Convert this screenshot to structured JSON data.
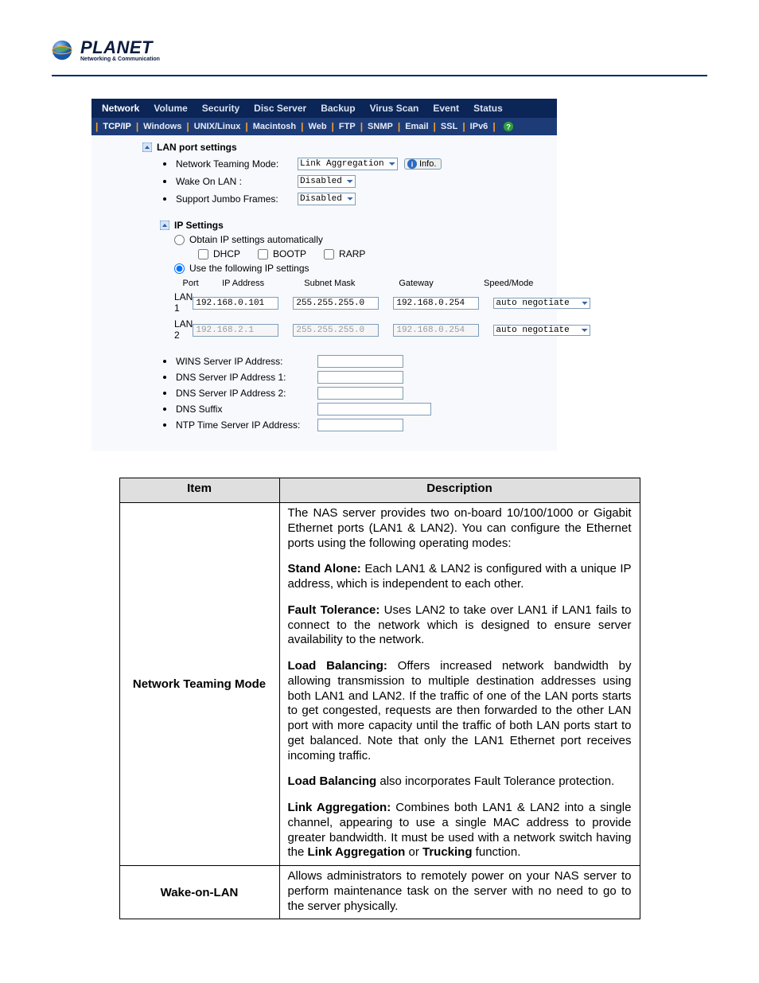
{
  "logo": {
    "brand": "PLANET",
    "tagline": "Networking & Communication"
  },
  "nav": {
    "tabs": [
      "Network",
      "Volume",
      "Security",
      "Disc Server",
      "Backup",
      "Virus Scan",
      "Event",
      "Status"
    ],
    "active": 0
  },
  "subnav": {
    "tabs": [
      "TCP/IP",
      "Windows",
      "UNIX/Linux",
      "Macintosh",
      "Web",
      "FTP",
      "SNMP",
      "Email",
      "SSL",
      "IPv6"
    ],
    "active": 0
  },
  "lan_port": {
    "heading": "LAN port settings",
    "teaming_label": "Network Teaming Mode:",
    "teaming_value": "Link Aggregation",
    "info_label": "Info.",
    "wol_label": "Wake On LAN :",
    "wol_value": "Disabled",
    "jumbo_label": "Support Jumbo Frames:",
    "jumbo_value": "Disabled"
  },
  "ip_settings": {
    "heading": "IP Settings",
    "auto_label": "Obtain IP settings automatically",
    "dhcp": "DHCP",
    "bootp": "BOOTP",
    "rarp": "RARP",
    "manual_label": "Use the following IP settings",
    "columns": {
      "port": "Port",
      "ip": "IP Address",
      "mask": "Subnet Mask",
      "gw": "Gateway",
      "speed": "Speed/Mode"
    },
    "rows": [
      {
        "port": "LAN 1",
        "ip": "192.168.0.101",
        "mask": "255.255.255.0",
        "gw": "192.168.0.254",
        "speed": "auto negotiate",
        "enabled": true
      },
      {
        "port": "LAN 2",
        "ip": "192.168.2.1",
        "mask": "255.255.255.0",
        "gw": "192.168.0.254",
        "speed": "auto negotiate",
        "enabled": false
      }
    ]
  },
  "servers": {
    "wins": "WINS Server IP Address:",
    "dns1": "DNS Server IP Address 1:",
    "dns2": "DNS Server IP Address 2:",
    "suffix": "DNS Suffix",
    "ntp": "NTP Time Server IP Address:"
  },
  "doc": {
    "header_item": "Item",
    "header_desc": "Description",
    "rows": [
      {
        "item": "Network Teaming Mode",
        "paragraphs": [
          {
            "text": "The NAS server provides two on-board 10/100/1000 or Gigabit Ethernet ports (LAN1 & LAN2). You can configure the Ethernet ports using the following operating modes:"
          },
          {
            "lead": "Stand Alone:",
            "text": " Each LAN1 & LAN2 is configured with a unique IP address, which is independent to each other."
          },
          {
            "lead": "Fault Tolerance:",
            "text": " Uses LAN2 to take over LAN1 if LAN1 fails to connect to the network which is designed to ensure server availability to the network."
          },
          {
            "lead": "Load Balancing:",
            "text": " Offers increased network bandwidth by allowing transmission to multiple destination addresses using both LAN1 and LAN2. If the traffic of one of the LAN ports starts to get congested, requests are then forwarded to the other LAN port with more capacity until the traffic of both LAN ports start to get balanced. Note that only the LAN1 Ethernet port receives incoming traffic."
          },
          {
            "lead": "Load Balancing",
            "text": " also incorporates Fault Tolerance protection."
          },
          {
            "lead": "Link Aggregation:",
            "text_before": " Combines both LAN1 & LAN2 into a single channel, appearing to use a single MAC address to provide greater bandwidth. It must be used with a network switch having the ",
            "bold_mid1": "Link Aggregation",
            "mid": " or ",
            "bold_mid2": "Trucking",
            "text_after": " function."
          }
        ]
      },
      {
        "item": "Wake-on-LAN",
        "paragraphs": [
          {
            "text": "Allows administrators to remotely power on your NAS server to perform maintenance task on the server with no need to go to the server physically."
          }
        ]
      }
    ]
  }
}
